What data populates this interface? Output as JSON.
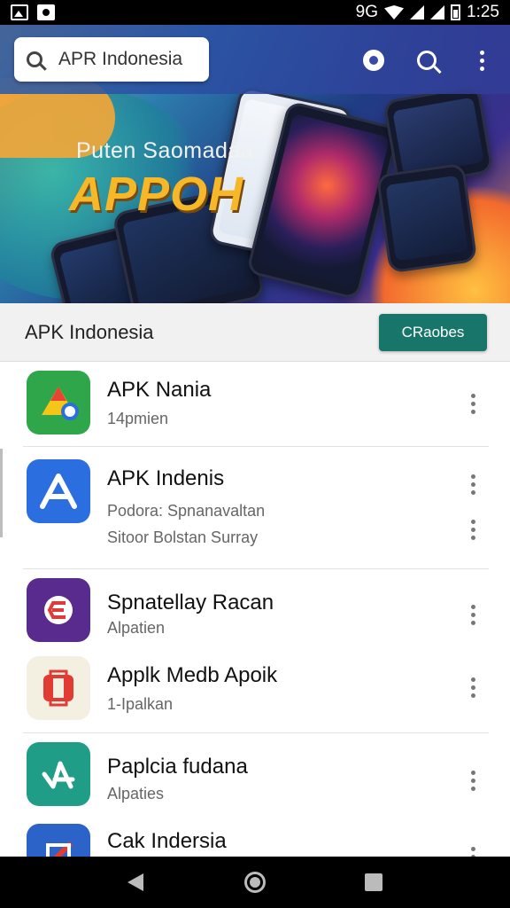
{
  "status_bar": {
    "carrier": "9G",
    "time": "1:25"
  },
  "header": {
    "search": {
      "value": "APR Indonesia"
    },
    "icons": [
      "settings-icon",
      "scan-icon",
      "more-vert-icon"
    ]
  },
  "banner": {
    "subtitle": "Puten Saomadaa",
    "title": "APPOH"
  },
  "title_bar": {
    "title": "APK Indonesia",
    "button_label": "CRaobes"
  },
  "apps": [
    {
      "name": "APK Nania",
      "sub": "14pmien",
      "sub2": "",
      "icon": "google-drive-style-icon",
      "color": "#2fa64a"
    },
    {
      "name": "APK Indenis",
      "sub": "Podora: Spnanavaltan",
      "sub2": "Sitoor Bolstan Surray",
      "icon": "app-store-a-icon",
      "color": "#2b6ee0"
    },
    {
      "name": "Spnatellay Racan",
      "sub": "Alpatien",
      "sub2": "",
      "icon": "purple-e-icon",
      "color": "#5a2b8f"
    },
    {
      "name": "Applk Medb Apoik",
      "sub": "1-Ipalkan",
      "sub2": "",
      "icon": "red-box-icon",
      "color": "#f3efe1"
    },
    {
      "name": "Paplcia fudana",
      "sub": "Alpaties",
      "sub2": "",
      "icon": "teal-a-icon",
      "color": "#1f9d86"
    },
    {
      "name": "Cak Indersia",
      "sub": "",
      "sub2": "",
      "icon": "blue-red-icon",
      "color": "#2b63c9"
    }
  ],
  "accent_color": "#17756a"
}
